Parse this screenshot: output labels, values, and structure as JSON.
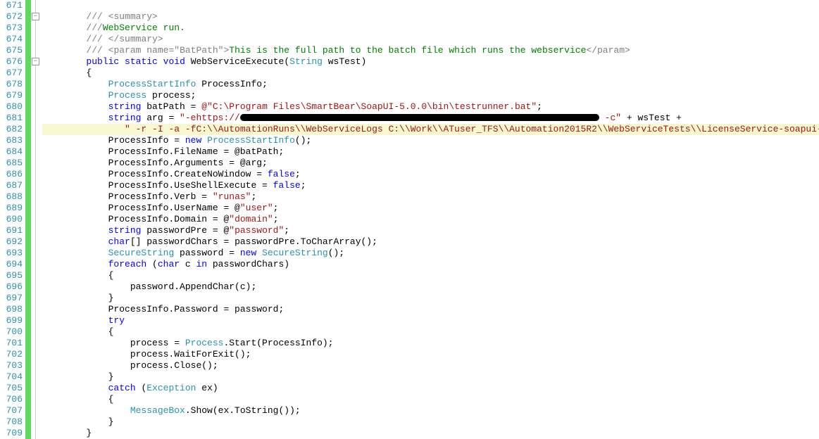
{
  "lines": {
    "start": 671,
    "end": 709
  },
  "fold_icons": [
    {
      "line": 672,
      "symbol": "−"
    },
    {
      "line": 676,
      "symbol": "−"
    }
  ],
  "indent": {
    "l1": "        ",
    "l2": "            ",
    "l3": "                ",
    "l3b": "               "
  },
  "code": {
    "672": {
      "pre": "/// ",
      "tag": "<summary>"
    },
    "673": {
      "pre": "///",
      "txt": "WebService run."
    },
    "674": {
      "pre": "/// ",
      "tag": "</summary>"
    },
    "675": {
      "pre": "/// ",
      "tag1": "<param name=",
      "attr": "\"BatPath\"",
      "tag2": ">",
      "txt": "This is the full path to the batch file which runs the webservice",
      "tag3": "</param>"
    },
    "676": {
      "kw1": "public",
      "kw2": "static",
      "kw3": "void",
      "name": " WebServiceExecute(",
      "ptype": "String",
      "pname": " wsTest)"
    },
    "677": "{",
    "678": {
      "type": "ProcessStartInfo",
      "rest": " ProcessInfo;"
    },
    "679": {
      "type": "Process",
      "rest": " process;"
    },
    "680": {
      "kw": "string",
      "mid": " batPath = ",
      "at": "@",
      "str": "\"C:\\Program Files\\SmartBear\\SoapUI-5.0.0\\bin\\testrunner.bat\"",
      "end": ";"
    },
    "681": {
      "kw": "string",
      "mid": " arg = ",
      "str1": "\"-ehttps://",
      "redact_w": 510,
      "str2": " -c\"",
      "plus": " + wsTest +"
    },
    "682": {
      "str": "\" -r -I -a -fC:\\\\AutomationRuns\\\\WebServiceLogs C:\\\\Work\\\\ATuser_TFS\\\\Automation2015R2\\\\WebServiceTests\\\\LicenseService-soapui-project.xml\"",
      "end": ";"
    },
    "683": {
      "a": "ProcessInfo = ",
      "kw": "new",
      "sp": " ",
      "type": "ProcessStartInfo",
      "end": "();"
    },
    "684": "ProcessInfo.FileName = @batPath;",
    "685": "ProcessInfo.Arguments = @arg;",
    "686": {
      "a": "ProcessInfo.CreateNoWindow = ",
      "kw": "false",
      "end": ";"
    },
    "687": {
      "a": "ProcessInfo.UseShellExecute = ",
      "kw": "false",
      "end": ";"
    },
    "688": {
      "a": "ProcessInfo.Verb = ",
      "str": "\"runas\"",
      "end": ";"
    },
    "689": {
      "a": "ProcessInfo.UserName = @",
      "str": "\"user\"",
      "end": ";"
    },
    "690": {
      "a": "ProcessInfo.Domain = @",
      "str": "\"domain\"",
      "end": ";"
    },
    "691": {
      "kw": "string",
      "mid": " passwordPre = @",
      "str": "\"password\"",
      "end": ";"
    },
    "692": {
      "kw": "char",
      "mid": "[] passwordChars = passwordPre.ToCharArray();"
    },
    "693": {
      "type": "SecureString",
      "mid": " password = ",
      "kw": "new",
      "sp": " ",
      "type2": "SecureString",
      "end": "();"
    },
    "694": {
      "kw": "foreach",
      "mid": " (",
      "kw2": "char",
      "rest": " c ",
      "kw3": "in",
      "rest2": " passwordChars)"
    },
    "695": "{",
    "696": "password.AppendChar(c);",
    "697": "}",
    "698": "ProcessInfo.Password = password;",
    "699": {
      "kw": "try"
    },
    "700": "{",
    "701": {
      "a": "process = ",
      "type": "Process",
      "end": ".Start(ProcessInfo);"
    },
    "702": "process.WaitForExit();",
    "703": "process.Close();",
    "704": "}",
    "705": {
      "kw": "catch",
      "mid": " (",
      "type": "Exception",
      "rest": " ex)"
    },
    "706": "{",
    "707": {
      "type": "MessageBox",
      "rest": ".Show(ex.ToString());"
    },
    "708": "}",
    "709": "}"
  }
}
